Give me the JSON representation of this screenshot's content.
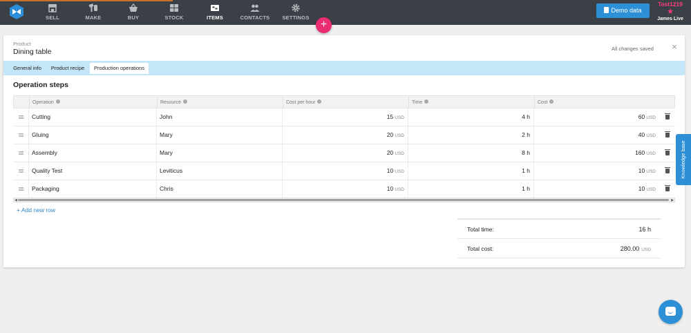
{
  "topnav": {
    "items": [
      {
        "label": "SELL",
        "icon": "shop-icon"
      },
      {
        "label": "MAKE",
        "icon": "hammer-wrench-icon"
      },
      {
        "label": "BUY",
        "icon": "basket-icon"
      },
      {
        "label": "STOCK",
        "icon": "boxes-icon"
      },
      {
        "label": "ITEMS",
        "icon": "tag-icon"
      },
      {
        "label": "CONTACTS",
        "icon": "people-icon"
      },
      {
        "label": "SETTINGS",
        "icon": "gear-icon"
      }
    ],
    "active": "ITEMS",
    "demo_button": "Demo data",
    "account_name": "Test1219",
    "account_star": "★",
    "user_name": "James Live",
    "add_symbol": "+"
  },
  "product": {
    "label": "Product",
    "name": "Dining table",
    "status": "All changes saved",
    "close_symbol": "×"
  },
  "tabs": [
    "General info",
    "Product recipe",
    "Production operations"
  ],
  "active_tab": "Production operations",
  "section_title": "Operation steps",
  "table": {
    "headers": [
      "Operation",
      "Resource",
      "Cost per hour",
      "Time",
      "Cost"
    ],
    "rows": [
      {
        "operation": "Cutting",
        "resource": "John",
        "cost_per_hour": "15",
        "cph_unit": "USD",
        "time": "4 h",
        "cost": "60",
        "cost_unit": "USD"
      },
      {
        "operation": "Gluing",
        "resource": "Mary",
        "cost_per_hour": "20",
        "cph_unit": "USD",
        "time": "2 h",
        "cost": "40",
        "cost_unit": "USD"
      },
      {
        "operation": "Assembly",
        "resource": "Mary",
        "cost_per_hour": "20",
        "cph_unit": "USD",
        "time": "8 h",
        "cost": "160",
        "cost_unit": "USD"
      },
      {
        "operation": "Quality Test",
        "resource": "Leviticus",
        "cost_per_hour": "10",
        "cph_unit": "USD",
        "time": "1 h",
        "cost": "10",
        "cost_unit": "USD"
      },
      {
        "operation": "Packaging",
        "resource": "Chris",
        "cost_per_hour": "10",
        "cph_unit": "USD",
        "time": "1 h",
        "cost": "10",
        "cost_unit": "USD"
      }
    ],
    "add_row": "+ Add new row"
  },
  "totals": {
    "time_label": "Total time:",
    "time_value": "16 h",
    "cost_label": "Total cost:",
    "cost_value": "280.00",
    "cost_unit": "USD"
  },
  "knowledge_base": "Knowledge base",
  "colors": {
    "nav_bg": "#3b3f46",
    "accent_blue": "#2d8fd6",
    "tab_strip": "#c5e6f8",
    "fab_pink": "#ea2d72",
    "account_pink": "#ff3d7f"
  }
}
